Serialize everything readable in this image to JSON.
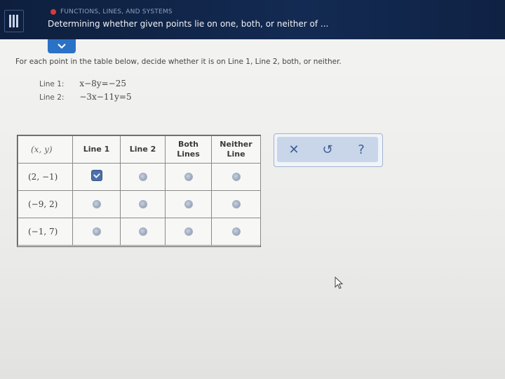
{
  "header": {
    "topic": "FUNCTIONS, LINES, AND SYSTEMS",
    "title": "Determining whether given points lie on one, both, or neither of ..."
  },
  "instructions": "For each point in the table below, decide whether it is on Line 1, Line 2, both, or neither.",
  "equations": [
    {
      "label": "Line 1:",
      "expr": "x−8y=−25"
    },
    {
      "label": "Line 2:",
      "expr": "−3x−11y=5"
    }
  ],
  "table": {
    "headers": {
      "point": "(x, y)",
      "line1": "Line 1",
      "line2": "Line 2",
      "both": "Both Lines",
      "neither": "Neither Line"
    },
    "rows": [
      {
        "point": "(2, −1)",
        "selected": "line1"
      },
      {
        "point": "(−9, 2)",
        "selected": null
      },
      {
        "point": "(−1, 7)",
        "selected": null
      }
    ]
  },
  "toolbar": {
    "clear_symbol": "✕",
    "undo_symbol": "↺",
    "help_symbol": "?"
  },
  "icons": [
    "menu-icon",
    "chevron-down-icon",
    "close-icon",
    "undo-icon",
    "help-icon",
    "cursor-icon"
  ],
  "colors": {
    "header_bg": "#132a52",
    "accent": "#2a72c6",
    "check": "#4c6fa8"
  }
}
